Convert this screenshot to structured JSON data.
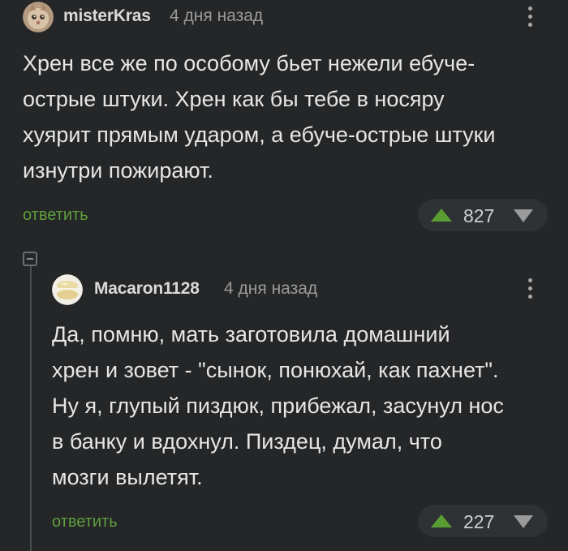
{
  "comments": [
    {
      "author": "misterKras",
      "time": "4 дня назад",
      "avatar_icon": "cat-avatar-icon",
      "text_lines": [
        "Хрен все же по особому бьет нежели ебуче-",
        "острые штуки. Хрен как бы тебе в носяру",
        "хуярит прямым ударом, а ебуче-острые штуки",
        "изнутри пожирают."
      ],
      "reply_label": "ответить",
      "rating": "827"
    },
    {
      "author": "Macaron1128",
      "time": "4 дня назад",
      "avatar_icon": "macaron-avatar-icon",
      "text_lines": [
        "Да, помню, мать заготовила домашний",
        "хрен и зовет - \"сынок, понюхай, как пахнет\".",
        "Ну я, глупый пиздюк, прибежал, засунул нос",
        "в банку и вдохнул. Пиздец, думал, что",
        "мозги вылетят."
      ],
      "reply_label": "ответить",
      "rating": "227"
    }
  ],
  "colors": {
    "background": "#242628",
    "text": "#e6e6e6",
    "reply_link": "#5e9e3c",
    "upvote": "#5a9e33",
    "downvote": "#9a9a9a"
  }
}
